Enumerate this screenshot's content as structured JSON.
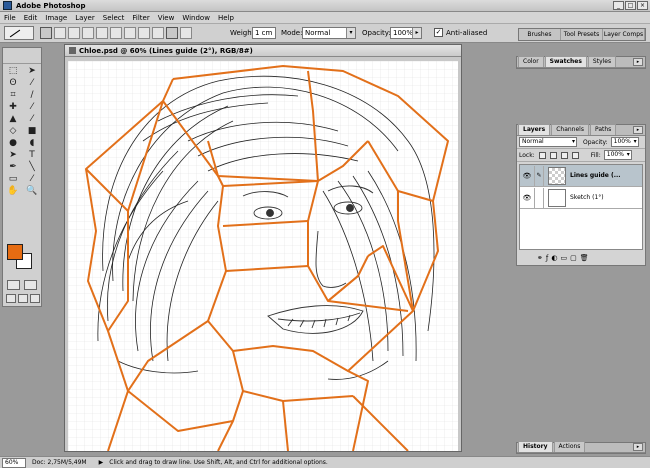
{
  "window": {
    "title": "Adobe Photoshop",
    "controls": [
      "_",
      "□",
      "×"
    ]
  },
  "menu": [
    "File",
    "Edit",
    "Image",
    "Layer",
    "Select",
    "Filter",
    "View",
    "Window",
    "Help"
  ],
  "options": {
    "weight_label": "Weight:",
    "weight_value": "1 cm",
    "mode_label": "Mode:",
    "mode_value": "Normal",
    "opacity_label": "Opacity:",
    "opacity_value": "100%",
    "antialias_label": "Anti-aliased",
    "antialias_checked": "✓"
  },
  "palette_well": [
    "Brushes",
    "Tool Presets",
    "Layer Comps"
  ],
  "document": {
    "title": "Chloe.psd @ 60% (Lines guide  (2°), RGB/8#)"
  },
  "color_panel": {
    "tabs": [
      "Color",
      "Swatches",
      "Styles"
    ]
  },
  "layers_panel": {
    "tabs": [
      "Layers",
      "Channels",
      "Paths"
    ],
    "blend_mode": "Normal",
    "opacity_label": "Opacity:",
    "opacity_value": "100%",
    "lock_label": "Lock:",
    "fill_label": "Fill:",
    "fill_value": "100%",
    "layers": [
      {
        "name": "Lines guide  (...",
        "selected": true
      },
      {
        "name": "Sketch  (1°)",
        "selected": false
      }
    ],
    "bottom_icons": [
      "⚭",
      "ƒ",
      "◐",
      "▭",
      "▢",
      "🗑"
    ]
  },
  "history_panel": {
    "tabs": [
      "History",
      "Actions"
    ]
  },
  "status": {
    "zoom": "60%",
    "doc": "Doc: 2,75M/5,49M",
    "hint": "Click and drag to draw line.  Use Shift, Alt, and Ctrl for additional options."
  },
  "colors": {
    "guide_line": "#e2701a",
    "foreground": "#e66c12",
    "background": "#ffffff"
  }
}
